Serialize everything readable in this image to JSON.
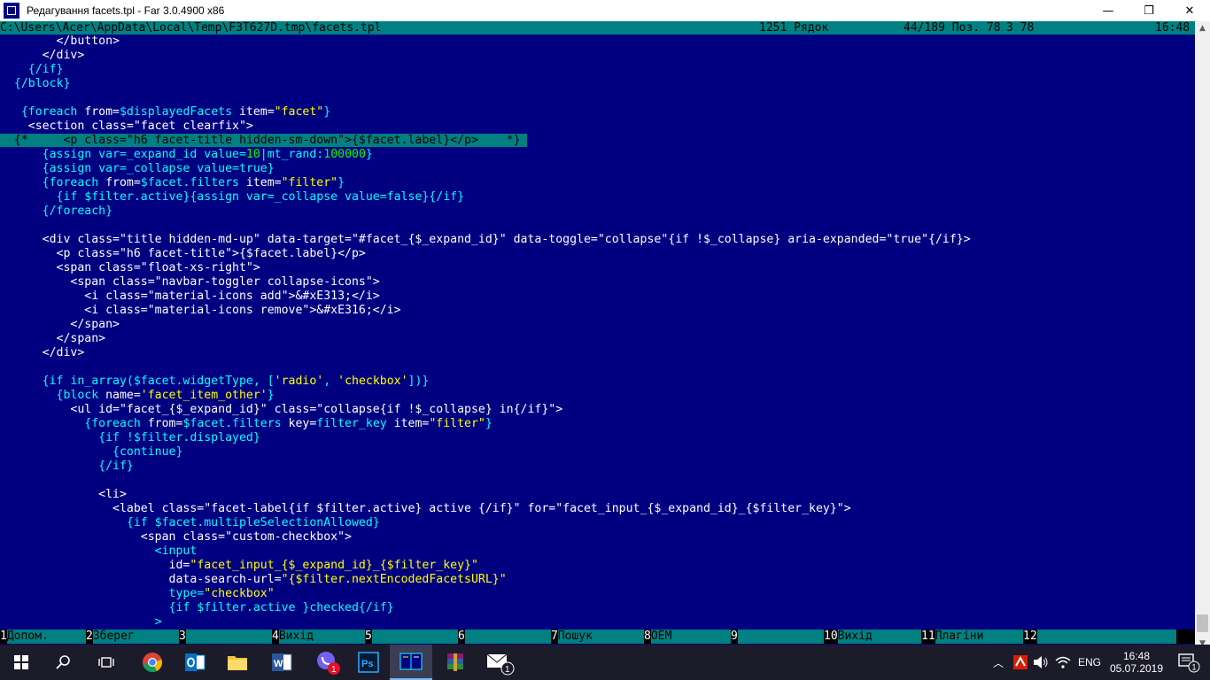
{
  "window": {
    "title": "Редагування facets.tpl - Far 3.0.4900 x86",
    "min_glyph": "—",
    "max_glyph": "❐",
    "close_glyph": "✕"
  },
  "status": {
    "path": "C:\\Users\\Acer\\AppData\\Local\\Temp\\F3T627D.tmp\\facets.tpl",
    "codepage": "1251 Рядок",
    "line_info": "44/189 Поз. 78",
    "col_info": "3 78",
    "time": "16:48"
  },
  "editor_lines": [
    [
      [
        "t",
        "        </button>"
      ]
    ],
    [
      [
        "t",
        "      </div>"
      ]
    ],
    [
      [
        "b",
        "    {/if}"
      ]
    ],
    [
      [
        "b",
        "  {/block}"
      ]
    ],
    [
      [
        "t",
        ""
      ]
    ],
    [
      [
        "b",
        "   {foreach "
      ],
      [
        "t",
        "from="
      ],
      [
        "b",
        "$displayedFacets "
      ],
      [
        "t",
        "item="
      ],
      [
        "y",
        "\"facet\""
      ],
      [
        "b",
        "}"
      ]
    ],
    [
      [
        "t",
        "    <section class=\"facet clearfix\">"
      ]
    ],
    [
      [
        "sel",
        "  {*     <p class=\"h6 facet-title hidden-sm-down\">{$facet.label}</p>    *} "
      ]
    ],
    [
      [
        "b",
        "      {assign var=_expand_id value="
      ],
      [
        "g",
        "10"
      ],
      [
        "b",
        "|mt_rand:"
      ],
      [
        "g",
        "100000"
      ],
      [
        "b",
        "}"
      ]
    ],
    [
      [
        "b",
        "      {assign var=_collapse value=true}"
      ]
    ],
    [
      [
        "b",
        "      {foreach "
      ],
      [
        "t",
        "from="
      ],
      [
        "b",
        "$facet.filters "
      ],
      [
        "t",
        "item="
      ],
      [
        "y",
        "\"filter\""
      ],
      [
        "b",
        "}"
      ]
    ],
    [
      [
        "b",
        "        {if $filter.active}{assign var=_collapse value=false}{/if}"
      ]
    ],
    [
      [
        "b",
        "      {/foreach}"
      ]
    ],
    [
      [
        "t",
        ""
      ]
    ],
    [
      [
        "t",
        "      <div class=\"title hidden-md-up\" data-target=\"#facet_{$_expand_id}\" data-toggle=\"collapse\"{if !$_collapse} aria-expanded=\"true\"{/if}>"
      ]
    ],
    [
      [
        "t",
        "        <p class=\"h6 facet-title\">{$facet.label}</p>"
      ]
    ],
    [
      [
        "t",
        "        <span class=\"float-xs-right\">"
      ]
    ],
    [
      [
        "t",
        "          <span class=\"navbar-toggler collapse-icons\">"
      ]
    ],
    [
      [
        "t",
        "            <i class=\"material-icons add\">&#xE313;</i>"
      ]
    ],
    [
      [
        "t",
        "            <i class=\"material-icons remove\">&#xE316;</i>"
      ]
    ],
    [
      [
        "t",
        "          </span>"
      ]
    ],
    [
      [
        "t",
        "        </span>"
      ]
    ],
    [
      [
        "t",
        "      </div>"
      ]
    ],
    [
      [
        "t",
        ""
      ]
    ],
    [
      [
        "b",
        "      {if in_array($facet.widgetType, ["
      ],
      [
        "y",
        "'radio'"
      ],
      [
        "b",
        ", "
      ],
      [
        "y",
        "'checkbox'"
      ],
      [
        "b",
        "])}"
      ]
    ],
    [
      [
        "b",
        "        {block "
      ],
      [
        "t",
        "name="
      ],
      [
        "y",
        "'facet_item_other'"
      ],
      [
        "b",
        "}"
      ]
    ],
    [
      [
        "t",
        "          <ul id=\"facet_{$_expand_id}\" class=\"collapse{if !$_collapse} in{/if}\">"
      ]
    ],
    [
      [
        "b",
        "            {foreach "
      ],
      [
        "t",
        "from="
      ],
      [
        "b",
        "$facet.filters "
      ],
      [
        "t",
        "key="
      ],
      [
        "b",
        "filter_key "
      ],
      [
        "t",
        "item="
      ],
      [
        "y",
        "\"filter\""
      ],
      [
        "b",
        "}"
      ]
    ],
    [
      [
        "b",
        "              {if !$filter.displayed}"
      ]
    ],
    [
      [
        "b",
        "                {continue}"
      ]
    ],
    [
      [
        "b",
        "              {/if}"
      ]
    ],
    [
      [
        "t",
        ""
      ]
    ],
    [
      [
        "t",
        "              <li>"
      ]
    ],
    [
      [
        "t",
        "                <label class=\"facet-label{if $filter.active} active {/if}\" for=\"facet_input_{$_expand_id}_{$filter_key}\">"
      ]
    ],
    [
      [
        "b",
        "                  {if $facet.multipleSelectionAllowed}"
      ]
    ],
    [
      [
        "t",
        "                    <span class=\"custom-checkbox\">"
      ]
    ],
    [
      [
        "b",
        "                      <input"
      ]
    ],
    [
      [
        "t",
        "                        id="
      ],
      [
        "y",
        "\"facet_input_{$_expand_id}_{$filter_key}\""
      ]
    ],
    [
      [
        "t",
        "                        data-search-url="
      ],
      [
        "y",
        "\"{$filter.nextEncodedFacetsURL}\""
      ]
    ],
    [
      [
        "b",
        "                        type="
      ],
      [
        "y",
        "\"checkbox\""
      ]
    ],
    [
      [
        "b",
        "                        {if $filter.active }checked{/if}"
      ]
    ],
    [
      [
        "b",
        "                      >"
      ]
    ]
  ],
  "keybar": [
    {
      "num": "1",
      "label": "Допом."
    },
    {
      "num": "2",
      "label": "Зберег"
    },
    {
      "num": "3",
      "label": ""
    },
    {
      "num": "4",
      "label": "Вихід"
    },
    {
      "num": "5",
      "label": ""
    },
    {
      "num": "6",
      "label": ""
    },
    {
      "num": "7",
      "label": "Пошук"
    },
    {
      "num": "8",
      "label": "OEM"
    },
    {
      "num": "9",
      "label": ""
    },
    {
      "num": "10",
      "label": "Вихід"
    },
    {
      "num": "11",
      "label": "Плагіни"
    },
    {
      "num": "12",
      "label": ""
    }
  ],
  "taskbar": {
    "language": "ENG",
    "clock_time": "16:48",
    "clock_date": "05.07.2019",
    "viber_badge": "1",
    "mail_badge": "1",
    "notif_badge": "1"
  },
  "colors": {
    "editor_bg": "#000080",
    "status_bg": "#008080",
    "text_white": "#ffffff",
    "text_cyan": "#00ffff",
    "text_yellow": "#ffff00",
    "text_green": "#00ff00"
  }
}
